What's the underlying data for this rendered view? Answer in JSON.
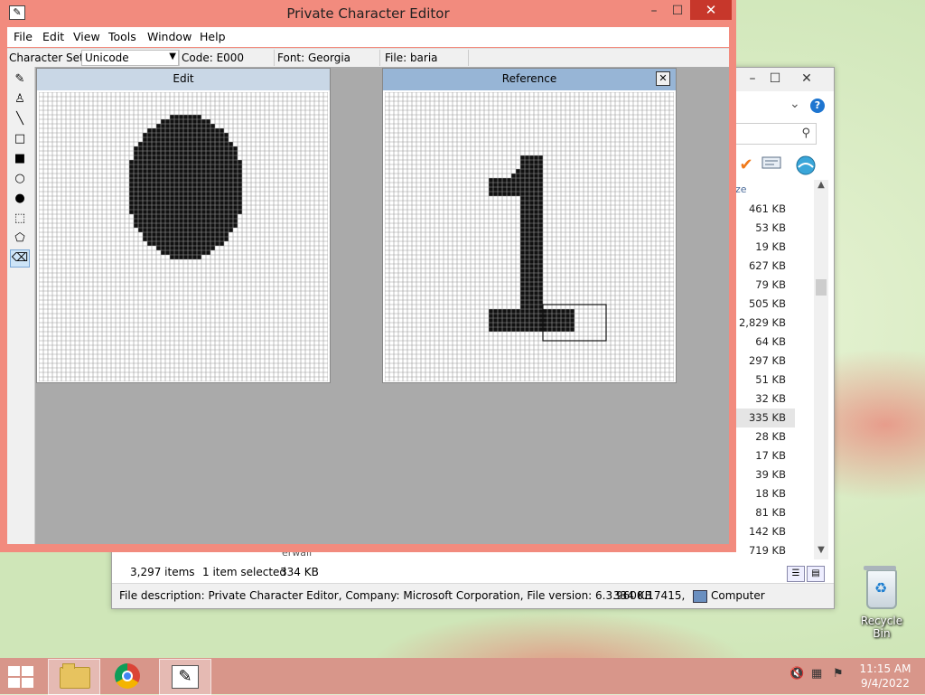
{
  "pce": {
    "title": "Private Character Editor",
    "menu": [
      "File",
      "Edit",
      "View",
      "Tools",
      "Window",
      "Help"
    ],
    "info": {
      "charset_label": "Character Set:",
      "charset_value": "Unicode",
      "code": "Code: E000",
      "font": "Font: Georgia",
      "file": "File: baria"
    },
    "edit_caption": "Edit",
    "reference_caption": "Reference",
    "icons": {
      "close": "✕",
      "minimize": "–",
      "maximize": "☐",
      "app": "✎",
      "ref_close": "✕"
    },
    "tools": [
      {
        "name": "pencil-icon",
        "glyph": "✎"
      },
      {
        "name": "brush-icon",
        "glyph": "♙"
      },
      {
        "name": "line-icon",
        "glyph": "╲"
      },
      {
        "name": "hollow-rectangle-icon",
        "glyph": "□"
      },
      {
        "name": "filled-rectangle-icon",
        "glyph": "■"
      },
      {
        "name": "hollow-ellipse-icon",
        "glyph": "○"
      },
      {
        "name": "filled-ellipse-icon",
        "glyph": "●"
      },
      {
        "name": "rectangular-selection-icon",
        "glyph": "⬚"
      },
      {
        "name": "freeform-selection-icon",
        "glyph": "⬠"
      },
      {
        "name": "eraser-icon",
        "glyph": "⌫"
      }
    ]
  },
  "explorer": {
    "column_header": "ze",
    "sizes": [
      "461 KB",
      "53 KB",
      "19 KB",
      "627 KB",
      "79 KB",
      "505 KB",
      "2,829 KB",
      "64 KB",
      "297 KB",
      "51 KB",
      "32 KB",
      "335 KB",
      "28 KB",
      "17 KB",
      "39 KB",
      "18 KB",
      "81 KB",
      "142 KB",
      "719 KB"
    ],
    "status": {
      "items": "3,297 items",
      "selected": "1 item selected",
      "size": "334 KB"
    },
    "desc": {
      "text": "File description: Private Character Editor, Company: Microsoft Corporation, File version: 6.3.9600.17415,",
      "size": "334 KB",
      "location": "Computer"
    },
    "partial_row": "erwall",
    "icons": {
      "minimize": "–",
      "maximize": "☐",
      "close": "✕",
      "help": "?",
      "chevron": "⌄",
      "search": "⚲",
      "check": "✔",
      "scroll_up": "▲",
      "scroll_down": "▼"
    }
  },
  "desktop": {
    "recycle_bin": "Recycle Bin"
  },
  "taskbar": {
    "time": "11:15 AM",
    "date": "9/4/2022",
    "tray_icons": [
      "volume-muted-icon",
      "network-icon",
      "action-center-icon"
    ]
  },
  "colors": {
    "accent": "#f28b7e",
    "close_red": "#c7372b",
    "caption_blue": "#97b5d6",
    "caption_light": "#c9d7e6",
    "pixel_on": "#111111"
  }
}
